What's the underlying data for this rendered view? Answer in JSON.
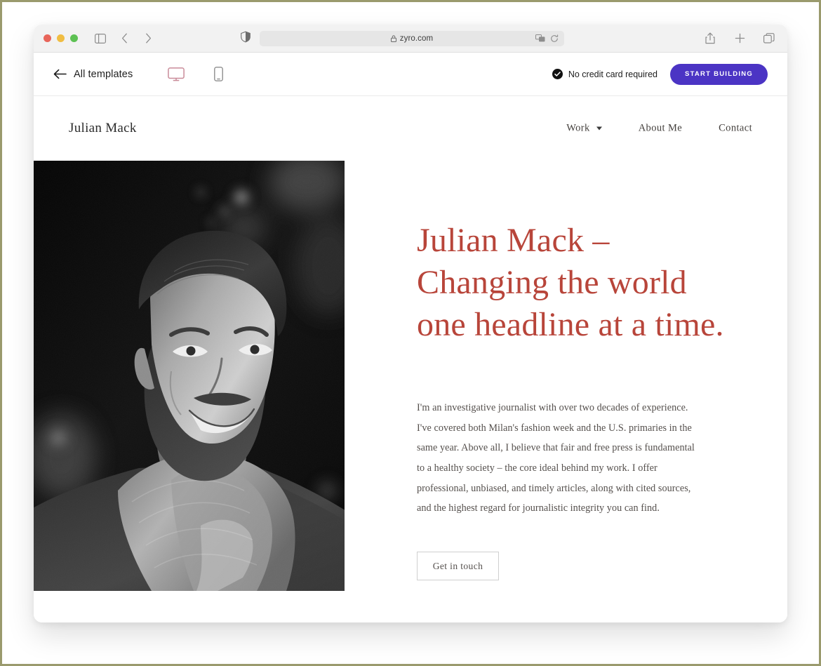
{
  "browser": {
    "traffic_lights": [
      "close",
      "minimize",
      "maximize"
    ],
    "url": "zyro.com",
    "lock_label": "secure",
    "sidebar_icon": "sidebar-icon",
    "back_icon": "chevron-left-icon",
    "forward_icon": "chevron-right-icon",
    "shield_icon": "privacy-shield-icon",
    "translate_icon": "translate-icon",
    "reload_icon": "reload-icon",
    "share_icon": "share-icon",
    "new_tab_icon": "plus-icon",
    "tabs_icon": "tab-overview-icon"
  },
  "zyro_toolbar": {
    "back_label": "All templates",
    "desktop_view": "desktop-preview",
    "mobile_view": "mobile-preview",
    "no_credit_card": "No credit card required",
    "start_building": "START BUILDING",
    "accent_purple": "#4B34C4",
    "active_device_color": "#C98B99"
  },
  "site": {
    "logo": "Julian Mack",
    "nav": [
      {
        "label": "Work",
        "has_dropdown": true
      },
      {
        "label": "About Me",
        "has_dropdown": false
      },
      {
        "label": "Contact",
        "has_dropdown": false
      }
    ],
    "hero": {
      "photo_alt": "Black and white portrait of a smiling bearded man wearing a scarf and coat",
      "title": "Julian Mack –\nChanging the world\none headline at a time.",
      "title_color": "#B8453A",
      "body": "I'm an investigative journalist with over two decades of experience. I've covered both Milan's fashion week and the U.S. primaries in the same year. Above all, I believe that fair and free press is fundamental to a healthy society – the core ideal behind my work. I offer professional, unbiased, and timely articles, along with cited sources, and the highest regard for journalistic integrity you can find.",
      "cta_label": "Get in touch"
    }
  }
}
